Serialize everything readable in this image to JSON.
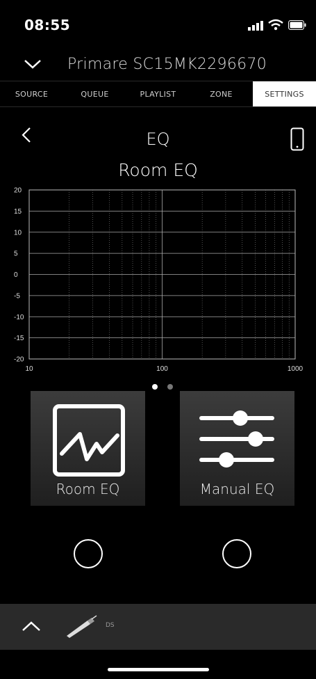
{
  "status": {
    "time": "08:55"
  },
  "device": {
    "name": "Primare SC15MK2296670"
  },
  "tabs": [
    {
      "label": "SOURCE"
    },
    {
      "label": "QUEUE"
    },
    {
      "label": "PLAYLIST"
    },
    {
      "label": "ZONE"
    },
    {
      "label": "SETTINGS",
      "active": true
    }
  ],
  "page": {
    "title": "EQ",
    "subtitle": "Room EQ"
  },
  "chart_data": {
    "type": "line",
    "x_scale": "log",
    "xlim": [
      10,
      1000
    ],
    "ylim": [
      -20,
      20
    ],
    "x_ticks": [
      "10",
      "100",
      "1000"
    ],
    "y_ticks": [
      "20",
      "15",
      "10",
      "5",
      "0",
      "-5",
      "-10",
      "-15",
      "-20"
    ],
    "grid": true,
    "series": []
  },
  "pager": {
    "pages": 2,
    "current": 1
  },
  "modes": [
    {
      "label": "Room EQ",
      "icon": "room-eq-graph-icon"
    },
    {
      "label": "Manual EQ",
      "icon": "sliders-icon"
    }
  ],
  "bottom": {
    "source_label": "DS"
  },
  "colors": {
    "background": "#000000",
    "tile": "#333333",
    "bar": "#2a2a2a",
    "active_tab": "#ffffff"
  }
}
